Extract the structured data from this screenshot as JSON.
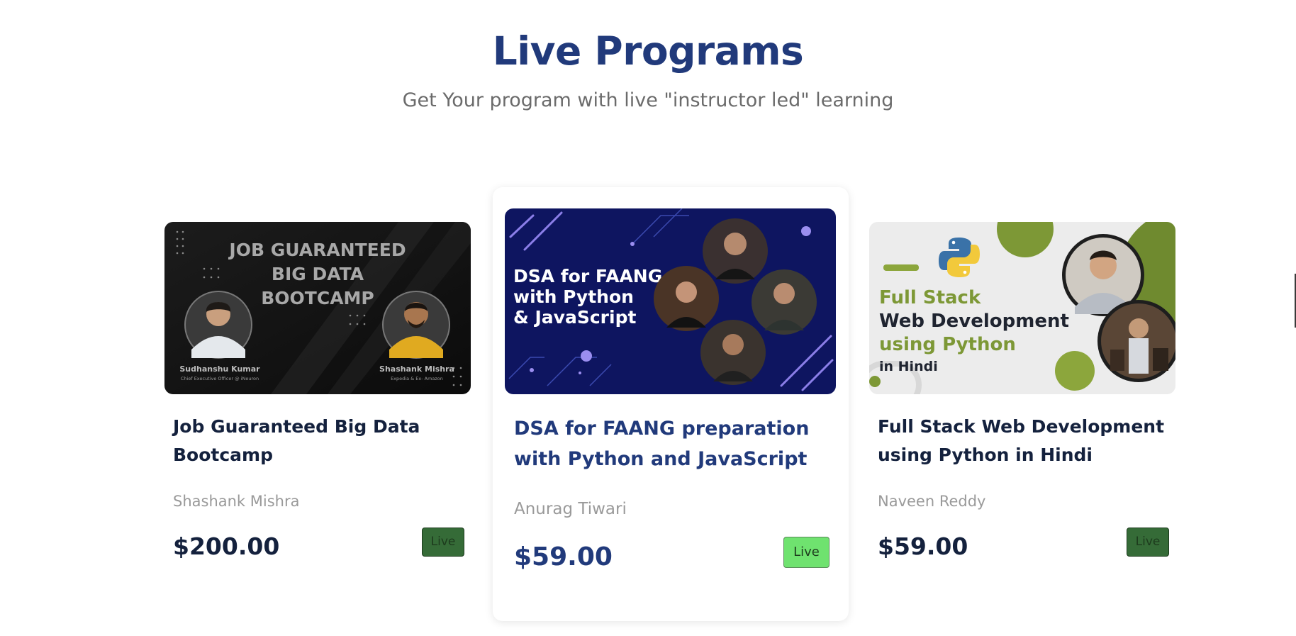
{
  "section": {
    "title": "Live Programs",
    "subtitle": "Get Your program with live \"instructor led\" learning"
  },
  "colors": {
    "heading": "#213a7b",
    "card_title": "#14213d",
    "muted_text": "#9a9a9a",
    "badge_dark": "#356b37",
    "badge_bright": "#6fe26f"
  },
  "cards": [
    {
      "title": "Job Guaranteed Big Data Bootcamp",
      "instructor": "Shashank Mishra",
      "price": "$200.00",
      "badge": "Live",
      "thumbnail": {
        "headline_1": "JOB GUARANTEED",
        "headline_2": "BIG DATA",
        "headline_3": "BOOTCAMP",
        "person_1_name": "Sudhanshu Kumar",
        "person_1_role": "Chief Executive Officer @ iNeuron",
        "person_2_name": "Shashank Mishra",
        "person_2_role": "Expedia & Ex- Amazon"
      }
    },
    {
      "title": "DSA for FAANG preparation with Python and JavaScript",
      "instructor": "Anurag Tiwari",
      "price": "$59.00",
      "badge": "Live",
      "thumbnail": {
        "line_1": "DSA for FAANG",
        "line_2": "with Python",
        "line_3": "& JavaScript"
      }
    },
    {
      "title": "Full Stack Web Development using Python in Hindi",
      "instructor": "Naveen Reddy",
      "price": "$59.00",
      "badge": "Live",
      "thumbnail": {
        "line_1": "Full Stack",
        "line_2": "Web Development",
        "line_3": "using Python",
        "line_4": "in Hindi",
        "logo_icon": "python-logo-icon"
      }
    }
  ]
}
